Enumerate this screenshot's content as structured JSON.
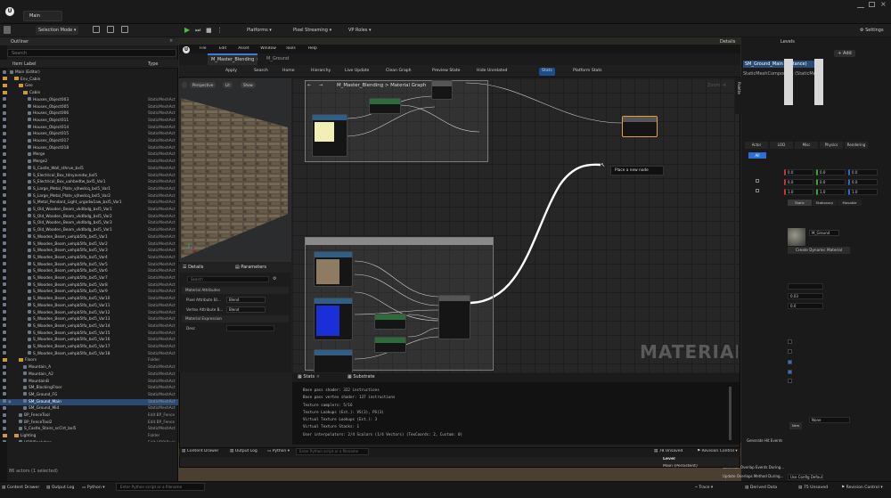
{
  "window": {
    "tab": "Main"
  },
  "toolbar": {
    "selection_mode": "Selection Mode",
    "platforms": "Platforms",
    "pixel_streaming": "Pixel Streaming",
    "vp_roles": "VP Roles",
    "settings": "Settings"
  },
  "outliner": {
    "title": "Outliner",
    "search_placeholder": "Search",
    "col_label": "Item Label",
    "col_type": "Type",
    "footer": "86 actors (1 selected)",
    "rows": [
      {
        "label": "Main (Editor)",
        "type": "",
        "indent": 1,
        "kind": "world"
      },
      {
        "label": "Env_Cabin",
        "type": "",
        "indent": 2,
        "kind": "fold"
      },
      {
        "label": "Geo",
        "type": "",
        "indent": 3,
        "kind": "fold"
      },
      {
        "label": "Cabin",
        "type": "",
        "indent": 4,
        "kind": "fold"
      },
      {
        "label": "Houses_Object003",
        "type": "StaticMeshAct",
        "indent": 5,
        "kind": "item"
      },
      {
        "label": "Houses_Object005",
        "type": "StaticMeshAct",
        "indent": 5,
        "kind": "item"
      },
      {
        "label": "Houses_Object006",
        "type": "StaticMeshAct",
        "indent": 5,
        "kind": "item"
      },
      {
        "label": "Houses_Object011",
        "type": "StaticMeshAct",
        "indent": 5,
        "kind": "item"
      },
      {
        "label": "Houses_Object014",
        "type": "StaticMeshAct",
        "indent": 5,
        "kind": "item"
      },
      {
        "label": "Houses_Object015",
        "type": "StaticMeshAct",
        "indent": 5,
        "kind": "item"
      },
      {
        "label": "Houses_Object017",
        "type": "StaticMeshAct",
        "indent": 5,
        "kind": "item"
      },
      {
        "label": "Houses_Object018",
        "type": "StaticMeshAct",
        "indent": 5,
        "kind": "item"
      },
      {
        "label": "Merge",
        "type": "StaticMeshAct",
        "indent": 5,
        "kind": "item"
      },
      {
        "label": "Merge2",
        "type": "StaticMeshAct",
        "indent": 5,
        "kind": "item"
      },
      {
        "label": "S_Castle_Wall_sthrue_bxl5",
        "type": "StaticMeshAct",
        "indent": 5,
        "kind": "item"
      },
      {
        "label": "S_Electrical_Box_tdnyavndw_bxl5",
        "type": "StaticMeshAct",
        "indent": 5,
        "kind": "item"
      },
      {
        "label": "S_Electrical_Box_uahbedtw_bxl5_Var1",
        "type": "StaticMeshAct",
        "indent": 5,
        "kind": "item"
      },
      {
        "label": "S_Large_Metal_Plate_vjhwdcq_bxl5_Var1",
        "type": "StaticMeshAct",
        "indent": 5,
        "kind": "item"
      },
      {
        "label": "S_Large_Metal_Plate_vjhwdcq_bxl5_Var2",
        "type": "StaticMeshAct",
        "indent": 5,
        "kind": "item"
      },
      {
        "label": "S_Metal_Pendant_Light_urgodw1aw_bxl5_Var1",
        "type": "StaticMeshAct",
        "indent": 5,
        "kind": "item"
      },
      {
        "label": "S_Old_Wooden_Beam_vkdlbdg_bxl5_Var1",
        "type": "StaticMeshAct",
        "indent": 5,
        "kind": "item"
      },
      {
        "label": "S_Old_Wooden_Beam_vkdlbdg_bxl5_Var2",
        "type": "StaticMeshAct",
        "indent": 5,
        "kind": "item"
      },
      {
        "label": "S_Old_Wooden_Beam_vkdlbdg_bxl5_Var3",
        "type": "StaticMeshAct",
        "indent": 5,
        "kind": "item"
      },
      {
        "label": "S_Old_Wooden_Beam_vkdlbdg_bxl5_Var1",
        "type": "StaticMeshAct",
        "indent": 5,
        "kind": "item"
      },
      {
        "label": "S_Wooden_Beam_uehpb5lfa_bxl5_Var1",
        "type": "StaticMeshAct",
        "indent": 5,
        "kind": "item"
      },
      {
        "label": "S_Wooden_Beam_uehpb5lfa_bxl5_Var2",
        "type": "StaticMeshAct",
        "indent": 5,
        "kind": "item"
      },
      {
        "label": "S_Wooden_Beam_uehpb5lfa_bxl5_Var3",
        "type": "StaticMeshAct",
        "indent": 5,
        "kind": "item"
      },
      {
        "label": "S_Wooden_Beam_uehpb5lfa_bxl5_Var4",
        "type": "StaticMeshAct",
        "indent": 5,
        "kind": "item"
      },
      {
        "label": "S_Wooden_Beam_uehpb5lfa_bxl5_Var5",
        "type": "StaticMeshAct",
        "indent": 5,
        "kind": "item"
      },
      {
        "label": "S_Wooden_Beam_uehpb5lfa_bxl5_Var6",
        "type": "StaticMeshAct",
        "indent": 5,
        "kind": "item"
      },
      {
        "label": "S_Wooden_Beam_uehpb5lfa_bxl5_Var7",
        "type": "StaticMeshAct",
        "indent": 5,
        "kind": "item"
      },
      {
        "label": "S_Wooden_Beam_uehpb5lfa_bxl5_Var8",
        "type": "StaticMeshAct",
        "indent": 5,
        "kind": "item"
      },
      {
        "label": "S_Wooden_Beam_uehpb5lfa_bxl5_Var9",
        "type": "StaticMeshAct",
        "indent": 5,
        "kind": "item"
      },
      {
        "label": "S_Wooden_Beam_uehpb5lfa_bxl5_Var10",
        "type": "StaticMeshAct",
        "indent": 5,
        "kind": "item"
      },
      {
        "label": "S_Wooden_Beam_uehpb5lfa_bxl5_Var11",
        "type": "StaticMeshAct",
        "indent": 5,
        "kind": "item"
      },
      {
        "label": "S_Wooden_Beam_uehpb5lfa_bxl5_Var12",
        "type": "StaticMeshAct",
        "indent": 5,
        "kind": "item"
      },
      {
        "label": "S_Wooden_Beam_uehpb5lfa_bxl5_Var13",
        "type": "StaticMeshAct",
        "indent": 5,
        "kind": "item"
      },
      {
        "label": "S_Wooden_Beam_uehpb5lfa_bxl5_Var14",
        "type": "StaticMeshAct",
        "indent": 5,
        "kind": "item"
      },
      {
        "label": "S_Wooden_Beam_uehpb5lfa_bxl5_Var15",
        "type": "StaticMeshAct",
        "indent": 5,
        "kind": "item"
      },
      {
        "label": "S_Wooden_Beam_uehpb5lfa_bxl5_Var16",
        "type": "StaticMeshAct",
        "indent": 5,
        "kind": "item"
      },
      {
        "label": "S_Wooden_Beam_uehpb5lfa_bxl5_Var17",
        "type": "StaticMeshAct",
        "indent": 5,
        "kind": "item"
      },
      {
        "label": "S_Wooden_Beam_uehpb5lfa_bxl5_Var18",
        "type": "StaticMeshAct",
        "indent": 5,
        "kind": "item"
      },
      {
        "label": "Floors",
        "type": "Folder",
        "indent": 3,
        "kind": "fold"
      },
      {
        "label": "Mountain_A",
        "type": "StaticMeshAct",
        "indent": 4,
        "kind": "item"
      },
      {
        "label": "Mountain_A2",
        "type": "StaticMeshAct",
        "indent": 4,
        "kind": "item"
      },
      {
        "label": "MountainB",
        "type": "StaticMeshAct",
        "indent": 4,
        "kind": "item"
      },
      {
        "label": "SM_BlockingFloor",
        "type": "StaticMeshAct",
        "indent": 4,
        "kind": "item"
      },
      {
        "label": "SM_Ground_FG",
        "type": "StaticMeshAct",
        "indent": 4,
        "kind": "item"
      },
      {
        "label": "SM_Ground_Main",
        "type": "StaticMeshAct",
        "indent": 4,
        "kind": "item",
        "selected": true
      },
      {
        "label": "SM_Ground_Mid",
        "type": "StaticMeshAct",
        "indent": 4,
        "kind": "item"
      },
      {
        "label": "BP_FenceTool",
        "type": "Edit BP_Fence",
        "indent": 3,
        "kind": "item"
      },
      {
        "label": "BP_FenceTool2",
        "type": "Edit BP_Fence",
        "indent": 3,
        "kind": "item"
      },
      {
        "label": "S_Castle_Stairs_scClrt_bxl5",
        "type": "StaticMeshAct",
        "indent": 3,
        "kind": "item"
      },
      {
        "label": "Lighting",
        "type": "Folder",
        "indent": 2,
        "kind": "fold"
      },
      {
        "label": "HDRIBackdrop",
        "type": "Edit HDRIBack",
        "indent": 3,
        "kind": "item"
      },
      {
        "label": "CabinShot",
        "type": "LevelSequenceAct",
        "indent": 2,
        "kind": "item"
      }
    ]
  },
  "material_editor": {
    "menu": [
      "File",
      "Edit",
      "Asset",
      "Window",
      "Tools",
      "Help"
    ],
    "tab_active": "M_Master_Blending",
    "tab_second": "M_Ground",
    "toolbar": [
      "Apply",
      "Search",
      "Home",
      "Hierarchy",
      "Live Update",
      "Clean Graph",
      "Preview State",
      "Hide Unrelated",
      "Stats",
      "Platform Stats"
    ],
    "preview": {
      "perspective": "Perspective",
      "lit": "Lit",
      "show": "Show"
    },
    "details_tab": "Details",
    "params_tab": "Parameters",
    "search_placeholder": "Search",
    "section_attributes": "Material Attributes",
    "pixel_attr_label": "Pixel Attribute Bl...",
    "pixel_attr_value": "Blend",
    "vertex_attr_label": "Vertex Attribute B...",
    "vertex_attr_value": "Blend",
    "section_expression": "Material Expression",
    "desc_label": "Desc",
    "breadcrumb": "M_Master_Blending > Material Graph",
    "zoom": "Zoom -4",
    "palette": "Palette",
    "context_menu": "Place a new node",
    "watermark": "MATERIAL",
    "stats_tab": "Stats",
    "substrate_tab": "Substrate",
    "stats_lines": [
      "Base pass shader: 322 instructions",
      "Base pass vertex shader: 137 instructions",
      "Texture samplers: 5/16",
      "Texture Lookups (Est.): VS(3), PS(3)",
      "Virtual Texture Lookups (Est.): 3",
      "Virtual Texture Stacks: 1",
      "User interpolators: 2/4 Scalars (1/4 Vectors) (TexCoords: 2, Custom: 0)"
    ],
    "bottom": {
      "content_drawer": "Content Drawer",
      "output_log": "Output Log",
      "cmd": "Python",
      "console_placeholder": "Enter Python script or a filename",
      "unsaved": "78 Unsaved",
      "revision": "Revision Control"
    }
  },
  "details_right": {
    "tab_details": "Details",
    "tab_levels": "Levels",
    "add_label": "Add",
    "name": "SM_Ground_Main (Instance)",
    "component": "StaticMeshComponent (StaticMeshComponent0)",
    "filter_tabs": [
      "Actor",
      "LOD",
      "Misc",
      "Physics",
      "Rendering"
    ],
    "all_tab": "All",
    "transform": [
      [
        "0.0",
        "0.0",
        "0.0"
      ],
      [
        "0.0",
        "0.0",
        "0.0"
      ],
      [
        "1.0",
        "1.0",
        "1.0"
      ]
    ],
    "mobility": [
      "Static",
      "Stationary",
      "Movable"
    ],
    "material_name": "M_Ground",
    "create_dynamic": "Create Dynamic Material",
    "val1": "0.03",
    "val2": "0.0",
    "level_label": "Level",
    "level_value": "Main (Persistent)",
    "none_label": "None",
    "props": [
      "Generate Hit Events",
      "Generate Overlap Events During...",
      "Update Overlaps Method During..."
    ],
    "use_config": "Use Config Default"
  },
  "statusbar": {
    "content_drawer": "Content Drawer",
    "output_log": "Output Log",
    "cmd": "Python",
    "console_placeholder": "Enter Python script or a filename",
    "trace": "Trace",
    "derived": "Derived Data",
    "unsaved": "75 Unsaved",
    "revision": "Revision Control"
  }
}
